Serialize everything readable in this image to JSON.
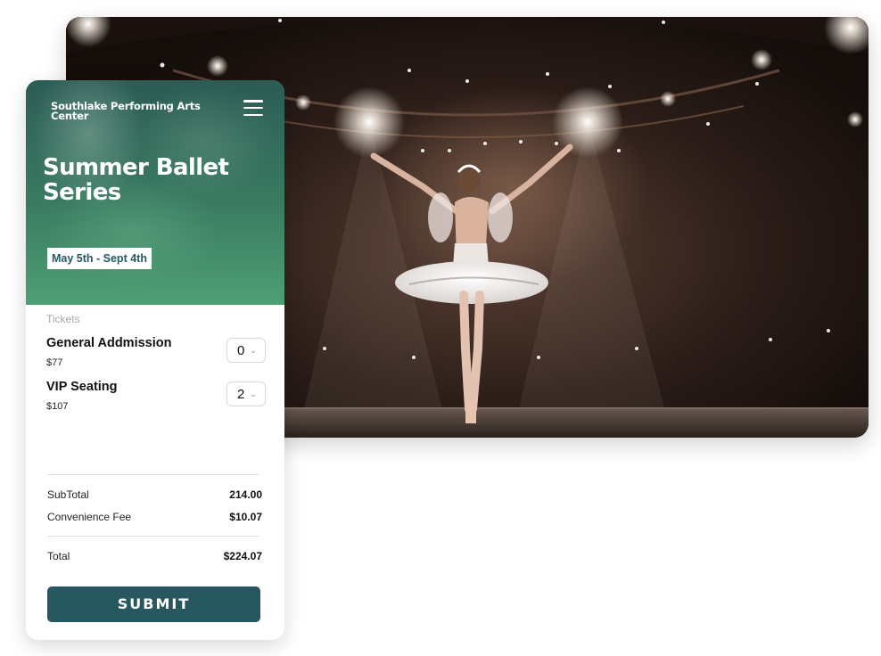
{
  "organization": {
    "name": "Southlake Performing Arts Center"
  },
  "event": {
    "title": "Summer Ballet Series",
    "dates": "May 5th - Sept 4th"
  },
  "tickets": {
    "section_label": "Tickets",
    "items": [
      {
        "name": "General Addmission",
        "price": "$77",
        "quantity": "0"
      },
      {
        "name": "VIP Seating",
        "price": "$107",
        "quantity": "2"
      }
    ]
  },
  "summary": {
    "subtotal_label": "SubTotal",
    "subtotal_value": "214.00",
    "fee_label": "Convenience Fee",
    "fee_value": "$10.07",
    "total_label": "Total",
    "total_value": "$224.07"
  },
  "actions": {
    "submit_label": "SUBMIT"
  },
  "icons": {
    "menu": "hamburger-menu-icon",
    "dropdown": "chevron-down-icon"
  },
  "colors": {
    "brand": "#28585f",
    "hero_green": "#4e9f74"
  }
}
